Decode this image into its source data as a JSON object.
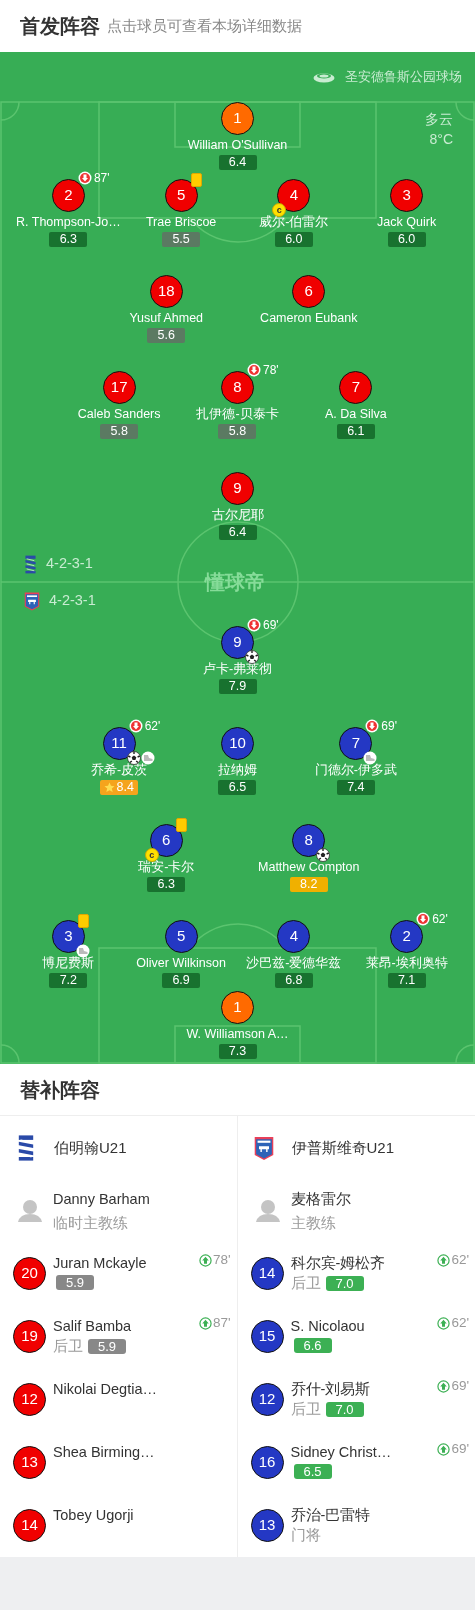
{
  "header": {
    "title": "首发阵容",
    "subtitle": "点击球员可查看本场详细数据"
  },
  "pitch": {
    "venue": "圣安德鲁斯公园球场",
    "weather": "多云",
    "temperature": "8°C",
    "pitch_mark": "懂球帝",
    "home_rows": [
      [
        {
          "number": "1",
          "name": "William O'Sullivan",
          "rating": "6.4",
          "kind": "good",
          "color": "#ff6a00"
        }
      ],
      [
        {
          "number": "2",
          "name": "R. Thompson-Jo…",
          "rating": "6.3",
          "kind": "good",
          "color": "#f00000",
          "events": [
            {
              "kind": "sub_off",
              "minute": "87'"
            }
          ]
        },
        {
          "number": "5",
          "name": "Trae Briscoe",
          "rating": "5.5",
          "kind": "poor",
          "color": "#f00000",
          "events": [
            {
              "kind": "yellow_card"
            }
          ]
        },
        {
          "number": "4",
          "name": "威尔-伯雷尔",
          "rating": "6.0",
          "kind": "good",
          "color": "#f00000",
          "events": [
            {
              "kind": "captain",
              "label": "c"
            }
          ]
        },
        {
          "number": "3",
          "name": "Jack Quirk",
          "rating": "6.0",
          "kind": "good",
          "color": "#f00000"
        }
      ],
      [
        {
          "number": "18",
          "name": "Yusuf Ahmed",
          "rating": "5.6",
          "kind": "poor",
          "color": "#f00000"
        },
        {
          "number": "6",
          "name": "Cameron Eubank",
          "color": "#f00000"
        }
      ],
      [
        {
          "number": "17",
          "name": "Caleb Sanders",
          "rating": "5.8",
          "kind": "poor",
          "color": "#f00000"
        },
        {
          "number": "8",
          "name": "扎伊德-贝泰卡",
          "rating": "5.8",
          "kind": "poor",
          "color": "#f00000",
          "events": [
            {
              "kind": "sub_off",
              "minute": "78'"
            }
          ]
        },
        {
          "number": "7",
          "name": "A. Da Silva",
          "rating": "6.1",
          "kind": "good",
          "color": "#f00000"
        }
      ],
      [
        {
          "number": "9",
          "name": "古尔尼耶",
          "rating": "6.4",
          "kind": "good",
          "color": "#f00000"
        }
      ]
    ],
    "formations": [
      {
        "kind": "home",
        "formation": "4-2-3-1"
      },
      {
        "kind": "away",
        "formation": "4-2-3-1"
      }
    ],
    "away_rows": [
      [
        {
          "number": "9",
          "name": "卢卡-弗莱彻",
          "rating": "7.9",
          "kind": "good",
          "color": "#2438c4",
          "events": [
            {
              "kind": "sub_off",
              "minute": "69'"
            },
            {
              "kind": "goal"
            }
          ]
        }
      ],
      [
        {
          "number": "11",
          "name": "乔希-皮茨",
          "rating": "8.4",
          "kind": "best",
          "color": "#2438c4",
          "events": [
            {
              "kind": "sub_off",
              "minute": "62'"
            },
            {
              "kind": "goal"
            },
            {
              "kind": "assist"
            }
          ]
        },
        {
          "number": "10",
          "name": "拉纳姆",
          "rating": "6.5",
          "kind": "good",
          "color": "#2438c4"
        },
        {
          "number": "7",
          "name": "门德尔-伊多武",
          "rating": "7.4",
          "kind": "good",
          "color": "#2438c4",
          "events": [
            {
              "kind": "sub_off",
              "minute": "69'"
            },
            {
              "kind": "assist"
            }
          ]
        }
      ],
      [
        {
          "number": "6",
          "name": "瑞安-卡尔",
          "rating": "6.3",
          "kind": "good",
          "color": "#2438c4",
          "events": [
            {
              "kind": "yellow_card"
            },
            {
              "kind": "captain",
              "label": "c"
            }
          ]
        },
        {
          "number": "8",
          "name": "Matthew Compton",
          "rating": "8.2",
          "kind": "top",
          "color": "#2438c4",
          "events": [
            {
              "kind": "goal"
            }
          ]
        }
      ],
      [
        {
          "number": "3",
          "name": "博尼费斯",
          "rating": "7.2",
          "kind": "good",
          "color": "#2438c4",
          "events": [
            {
              "kind": "yellow_card"
            },
            {
              "kind": "assist"
            }
          ]
        },
        {
          "number": "5",
          "name": "Oliver Wilkinson",
          "rating": "6.9",
          "kind": "good",
          "color": "#2438c4"
        },
        {
          "number": "4",
          "name": "沙巴兹-爱德华兹",
          "rating": "6.8",
          "kind": "good",
          "color": "#2438c4"
        },
        {
          "number": "2",
          "name": "莱昂-埃利奥特",
          "rating": "7.1",
          "kind": "good",
          "color": "#2438c4",
          "events": [
            {
              "kind": "sub_off",
              "minute": "62'"
            }
          ]
        }
      ],
      [
        {
          "number": "1",
          "name": "W. Williamson A…",
          "rating": "7.3",
          "kind": "good",
          "color": "#ff6a00"
        }
      ]
    ]
  },
  "substitutes": {
    "title": "替补阵容",
    "teams": [
      {
        "kind": "home",
        "team": "伯明翰U21",
        "coach": "Danny Barham",
        "coach_role": "临时主教练",
        "players": [
          {
            "number": "20",
            "name": "Juran Mckayle",
            "rating": "5.9",
            "kind": "poor",
            "on_minute": "78'",
            "color": "#f00000"
          },
          {
            "number": "19",
            "name": "Salif Bamba",
            "position": "后卫",
            "rating": "5.9",
            "kind": "poor",
            "on_minute": "87'",
            "color": "#f00000"
          },
          {
            "number": "12",
            "name": "Nikolai Degtia…",
            "color": "#f00000"
          },
          {
            "number": "13",
            "name": "Shea Birming…",
            "color": "#f00000"
          },
          {
            "number": "14",
            "name": "Tobey Ugorji",
            "color": "#f00000"
          }
        ]
      },
      {
        "kind": "away",
        "team": "伊普斯维奇U21",
        "coach": "麦格雷尔",
        "coach_role": "主教练",
        "players": [
          {
            "number": "14",
            "name": "科尔宾-姆松齐",
            "position": "后卫",
            "rating": "7.0",
            "kind": "good",
            "on_minute": "62'",
            "color": "#2438c4"
          },
          {
            "number": "15",
            "name": "S. Nicolaou",
            "rating": "6.6",
            "kind": "good",
            "on_minute": "62'",
            "color": "#2438c4"
          },
          {
            "number": "12",
            "name": "乔什-刘易斯",
            "position": "后卫",
            "rating": "7.0",
            "kind": "good",
            "on_minute": "69'",
            "color": "#2438c4"
          },
          {
            "number": "16",
            "name": "Sidney Christ…",
            "rating": "6.5",
            "kind": "good",
            "on_minute": "69'",
            "color": "#2438c4"
          },
          {
            "number": "13",
            "name": "乔治-巴雷特",
            "position": "门将",
            "color": "#2438c4"
          }
        ]
      }
    ]
  }
}
